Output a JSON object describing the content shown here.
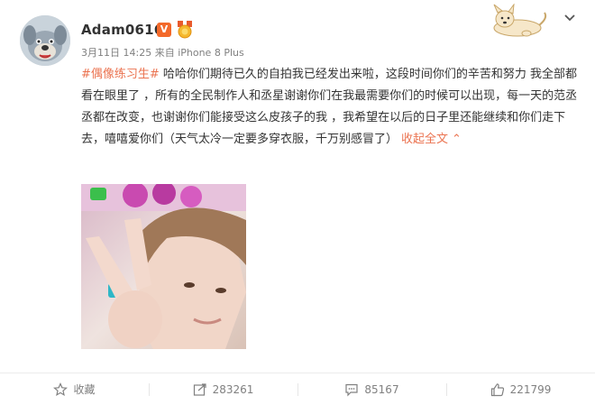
{
  "post": {
    "username": "Adam0616",
    "verified_badge": "V",
    "time": "3月11日 14:25",
    "source": "来自 iPhone 8 Plus",
    "hashtag": "#偶像练习生#",
    "body": " 哈哈你们期待已久的自拍我已经发出来啦，这段时间你们的辛苦和努力 我全部都看在眼里了 ，所有的全民制作人和丞星谢谢你们在我最需要你们的时候可以出现，每一天的范丞丞都在改变，也谢谢你们能接受这么皮孩子的我 ，我希望在以后的日子里还能继续和你们走下去，嘻嘻爱你们（天气太冷一定要多穿衣服，千万别感冒了）",
    "collapse_label": "收起全文",
    "collapse_chevron": "⌃"
  },
  "icons": {
    "avatar": "cartoon-dog-avatar-icon",
    "medal": "medal-icon",
    "sticker": "cartoon-dog-sticker-icon",
    "dropdown": "chevron-down-icon",
    "favorite": "star-icon",
    "repost": "share-icon",
    "comment": "comment-icon",
    "like": "thumbs-up-icon"
  },
  "actions": {
    "favorite_label": "收藏",
    "repost_count": "283261",
    "comment_count": "85167",
    "like_count": "221799"
  },
  "colors": {
    "link": "#eb7350",
    "verified": "#f3692a",
    "muted": "#808080"
  }
}
